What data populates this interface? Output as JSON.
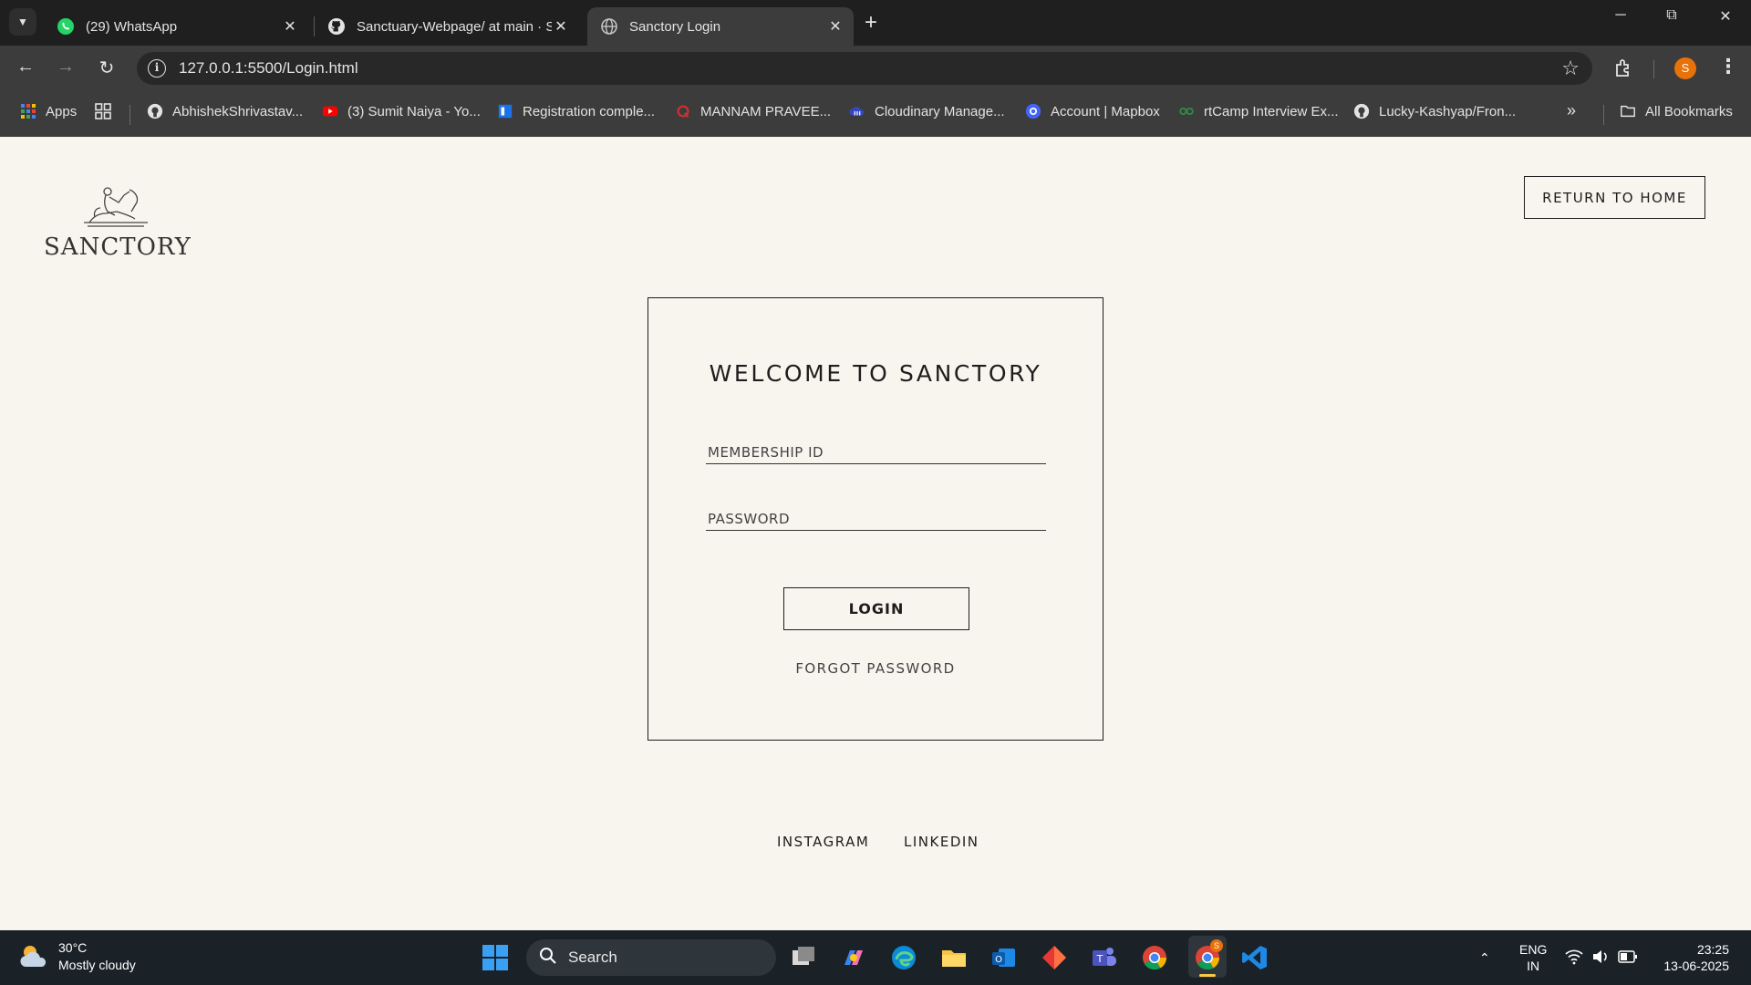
{
  "browser": {
    "tabs": [
      {
        "title": "(29) WhatsApp",
        "icon": "whatsapp-icon",
        "active": false
      },
      {
        "title": "Sanctuary-Webpage/ at main · Sa",
        "icon": "github-icon",
        "active": false
      },
      {
        "title": "Sanctory Login",
        "icon": "globe-icon",
        "active": true
      }
    ],
    "url": "127.0.0.1:5500/Login.html",
    "profile_initial": "S",
    "bookmarks": [
      {
        "label": "Apps",
        "icon": "apps-grid-icon"
      },
      {
        "label": "AbhishekShrivastav...",
        "icon": "github-icon"
      },
      {
        "label": "(3) Sumit Naiya - Yo...",
        "icon": "youtube-icon"
      },
      {
        "label": "Registration comple...",
        "icon": "doc-icon"
      },
      {
        "label": "MANNAM PRAVEE...",
        "icon": "q-icon"
      },
      {
        "label": "Cloudinary Manage...",
        "icon": "cloudinary-icon"
      },
      {
        "label": "Account | Mapbox",
        "icon": "mapbox-icon"
      },
      {
        "label": "rtCamp Interview Ex...",
        "icon": "gfg-icon"
      },
      {
        "label": "Lucky-Kashyap/Fron...",
        "icon": "github-icon"
      }
    ],
    "all_bookmarks": "All Bookmarks",
    "colors": {
      "tabbar": "#1f1f1f",
      "toolbar": "#3c3c3c",
      "avatar": "#e8710a"
    }
  },
  "page": {
    "logo_text": "SANCTORY",
    "return_home": "RETURN TO HOME",
    "card_title": "WELCOME TO SANCTORY",
    "membership_placeholder": "MEMBERSHIP ID",
    "password_placeholder": "PASSWORD",
    "login": "LOGIN",
    "forgot": "FORGOT PASSWORD",
    "instagram": "INSTAGRAM",
    "linkedin": "LINKEDIN",
    "colors": {
      "background": "#f8f5ef",
      "ink": "#1d1d1d"
    }
  },
  "taskbar": {
    "weather_temp": "30°C",
    "weather_desc": "Mostly cloudy",
    "search": "Search",
    "lang_1": "ENG",
    "lang_2": "IN",
    "time": "23:25",
    "date": "13-06-2025"
  }
}
